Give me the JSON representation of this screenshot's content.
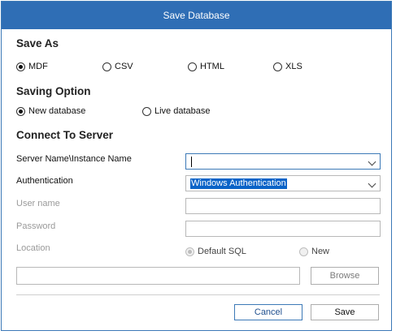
{
  "window": {
    "title": "Save Database"
  },
  "save_as": {
    "heading": "Save As",
    "options": [
      {
        "label": "MDF",
        "selected": true
      },
      {
        "label": "CSV",
        "selected": false
      },
      {
        "label": "HTML",
        "selected": false
      },
      {
        "label": "XLS",
        "selected": false
      }
    ]
  },
  "saving_option": {
    "heading": "Saving Option",
    "options": [
      {
        "label": "New database",
        "selected": true
      },
      {
        "label": "Live database",
        "selected": false
      }
    ]
  },
  "connect": {
    "heading": "Connect To Server",
    "server_label": "Server Name\\Instance Name",
    "server_value": "",
    "auth_label": "Authentication",
    "auth_value": "Windows Authentication",
    "username_label": "User name",
    "username_value": "",
    "password_label": "Password",
    "password_value": "",
    "location_label": "Location",
    "location_options": [
      {
        "label": "Default SQL",
        "selected": true
      },
      {
        "label": "New",
        "selected": false
      }
    ],
    "path_value": ""
  },
  "buttons": {
    "browse": "Browse",
    "cancel": "Cancel",
    "save": "Save"
  },
  "colors": {
    "titlebar": "#2f6eb5",
    "accent": "#3c79b7",
    "selection": "#0a64c8"
  },
  "icons": {
    "dropdown": "chevron-down-icon"
  }
}
